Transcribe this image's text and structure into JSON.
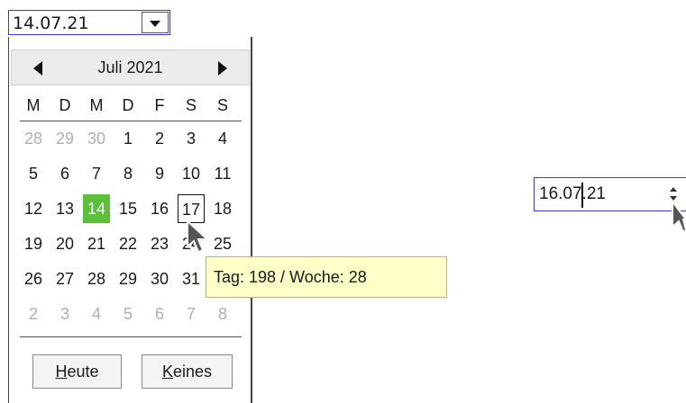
{
  "date_field": {
    "value": "14.07.21",
    "dropdown_icon": "chevron-down-icon"
  },
  "calendar": {
    "month_title": "Juli 2021",
    "prev_icon": "triangle-left-icon",
    "next_icon": "triangle-right-icon",
    "weekdays": [
      "M",
      "D",
      "M",
      "D",
      "F",
      "S",
      "S"
    ],
    "weeks": [
      [
        {
          "d": "28",
          "m": true
        },
        {
          "d": "29",
          "m": true
        },
        {
          "d": "30",
          "m": true
        },
        {
          "d": "1"
        },
        {
          "d": "2"
        },
        {
          "d": "3"
        },
        {
          "d": "4"
        }
      ],
      [
        {
          "d": "5"
        },
        {
          "d": "6"
        },
        {
          "d": "7"
        },
        {
          "d": "8"
        },
        {
          "d": "9"
        },
        {
          "d": "10"
        },
        {
          "d": "11"
        }
      ],
      [
        {
          "d": "12"
        },
        {
          "d": "13"
        },
        {
          "d": "14",
          "sel": true
        },
        {
          "d": "15"
        },
        {
          "d": "16"
        },
        {
          "d": "17",
          "today": true
        },
        {
          "d": "18"
        }
      ],
      [
        {
          "d": "19"
        },
        {
          "d": "20"
        },
        {
          "d": "21"
        },
        {
          "d": "22"
        },
        {
          "d": "23"
        },
        {
          "d": "24"
        },
        {
          "d": "25"
        }
      ],
      [
        {
          "d": "26"
        },
        {
          "d": "27"
        },
        {
          "d": "28"
        },
        {
          "d": "29"
        },
        {
          "d": "30"
        },
        {
          "d": "31"
        },
        {
          "d": ""
        }
      ],
      [
        {
          "d": "2",
          "m": true
        },
        {
          "d": "3",
          "m": true
        },
        {
          "d": "4",
          "m": true
        },
        {
          "d": "5",
          "m": true
        },
        {
          "d": "6",
          "m": true
        },
        {
          "d": "7",
          "m": true
        },
        {
          "d": "8",
          "m": true
        }
      ]
    ],
    "selected_color": "#5cbf3a",
    "today_button": {
      "mnemonic": "H",
      "rest": "eute"
    },
    "none_button": {
      "mnemonic": "K",
      "rest": "eines"
    }
  },
  "tooltip": {
    "text": "Tag: 198 / Woche: 28"
  },
  "spin_field": {
    "value": "16.07.21"
  }
}
